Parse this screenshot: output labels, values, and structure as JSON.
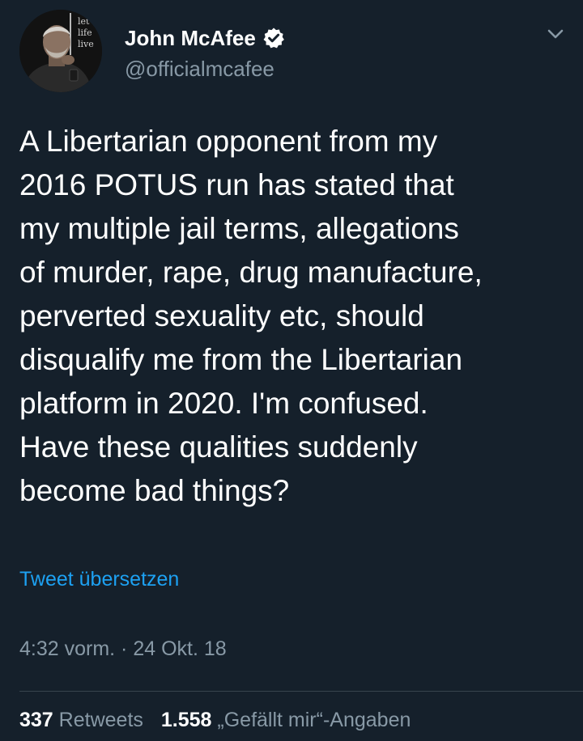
{
  "user": {
    "display_name": "John McAfee",
    "handle": "@officialmcafee",
    "avatar_text": [
      "let",
      "life",
      "live"
    ]
  },
  "tweet": {
    "lines": [
      "A Libertarian opponent from my",
      "2016 POTUS run has stated that",
      "my multiple jail terms, allegations",
      "of murder, rape, drug manufacture,",
      "perverted sexuality etc, should",
      "disqualify me from the Libertarian",
      "platform in 2020. I'm confused.",
      "Have these qualities suddenly",
      "become bad things?"
    ],
    "translate_label": "Tweet übersetzen",
    "timestamp": "4:32 vorm. · 24 Okt. 18"
  },
  "stats": {
    "retweets_count": "337",
    "retweets_label": "Retweets",
    "likes_count": "1.558",
    "likes_label": "„Gefällt mir“-Angaben"
  },
  "icons": {
    "verified": "verified-badge-icon",
    "menu": "chevron-down-icon"
  },
  "colors": {
    "background": "#15202b",
    "link": "#1da1f2",
    "secondary_text": "#8899a6",
    "divider": "#38444d"
  }
}
